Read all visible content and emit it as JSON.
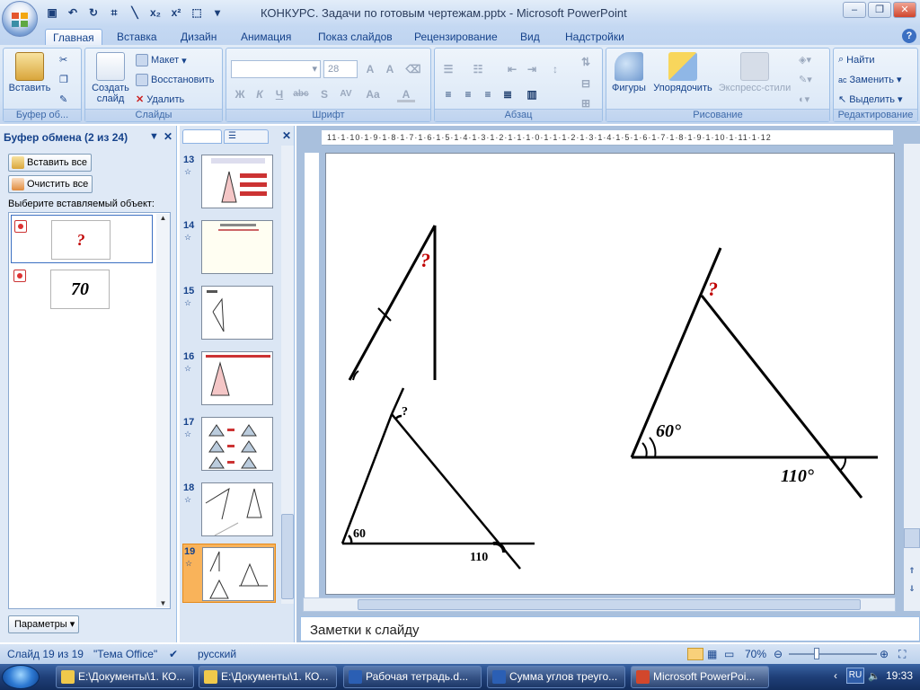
{
  "window": {
    "title": "КОНКУРС. Задачи по готовым чертежам.pptx - Microsoft PowerPoint"
  },
  "tabs": [
    {
      "label": "Главная"
    },
    {
      "label": "Вставка"
    },
    {
      "label": "Дизайн"
    },
    {
      "label": "Анимация"
    },
    {
      "label": "Показ слайдов"
    },
    {
      "label": "Рецензирование"
    },
    {
      "label": "Вид"
    },
    {
      "label": "Надстройки"
    }
  ],
  "ribbon": {
    "clipboard": {
      "paste": "Вставить",
      "label": "Буфер об..."
    },
    "slides": {
      "new_slide_1": "Создать",
      "new_slide_2": "слайд",
      "layout": "Макет",
      "reset": "Восстановить",
      "delete": "Удалить",
      "label": "Слайды"
    },
    "font": {
      "size": "28",
      "label": "Шрифт"
    },
    "paragraph": {
      "label": "Абзац"
    },
    "drawing": {
      "shapes": "Фигуры",
      "arrange": "Упорядочить",
      "styles": "Экспресс-стили",
      "label": "Рисование"
    },
    "editing": {
      "find": "Найти",
      "replace": "Заменить",
      "select": "Выделить",
      "label": "Редактирование"
    }
  },
  "clipboard_pane": {
    "title": "Буфер обмена (2 из 24)",
    "paste_all": "Вставить все",
    "clear_all": "Очистить все",
    "prompt": "Выберите вставляемый объект:",
    "items": [
      {
        "text": "?"
      },
      {
        "text": "70"
      }
    ],
    "options": "Параметры"
  },
  "slides": [
    {
      "num": "13"
    },
    {
      "num": "14"
    },
    {
      "num": "15"
    },
    {
      "num": "16"
    },
    {
      "num": "17"
    },
    {
      "num": "18"
    },
    {
      "num": "19"
    }
  ],
  "slide": {
    "q_top": "?",
    "q_right": "?",
    "angle60_right": "60°",
    "angle110_right": "110°",
    "q_bottom": "?",
    "angle60_bottom": "60",
    "angle110_bottom": "110"
  },
  "ruler": {
    "h": "11·1·10·1·9·1·8·1·7·1·6·1·5·1·4·1·3·1·2·1·1·1·0·1·1·1·2·1·3·1·4·1·5·1·6·1·7·1·8·1·9·1·10·1·11·1·12"
  },
  "notes": {
    "placeholder": "Заметки к слайду"
  },
  "status": {
    "slide": "Слайд 19 из 19",
    "theme": "\"Тема Office\"",
    "lang": "русский",
    "zoom": "70%"
  },
  "taskbar": {
    "items": [
      {
        "label": "E:\\Документы\\1. КО..."
      },
      {
        "label": "E:\\Документы\\1. КО..."
      },
      {
        "label": "Рабочая тетрадь.d..."
      },
      {
        "label": "Сумма углов треуго..."
      },
      {
        "label": "Microsoft PowerPoi..."
      }
    ],
    "lang": "RU",
    "clock": "19:33"
  },
  "colors": {
    "accent": "#15428b",
    "question": "#c00000",
    "selected_slide": "#f9b35a"
  }
}
